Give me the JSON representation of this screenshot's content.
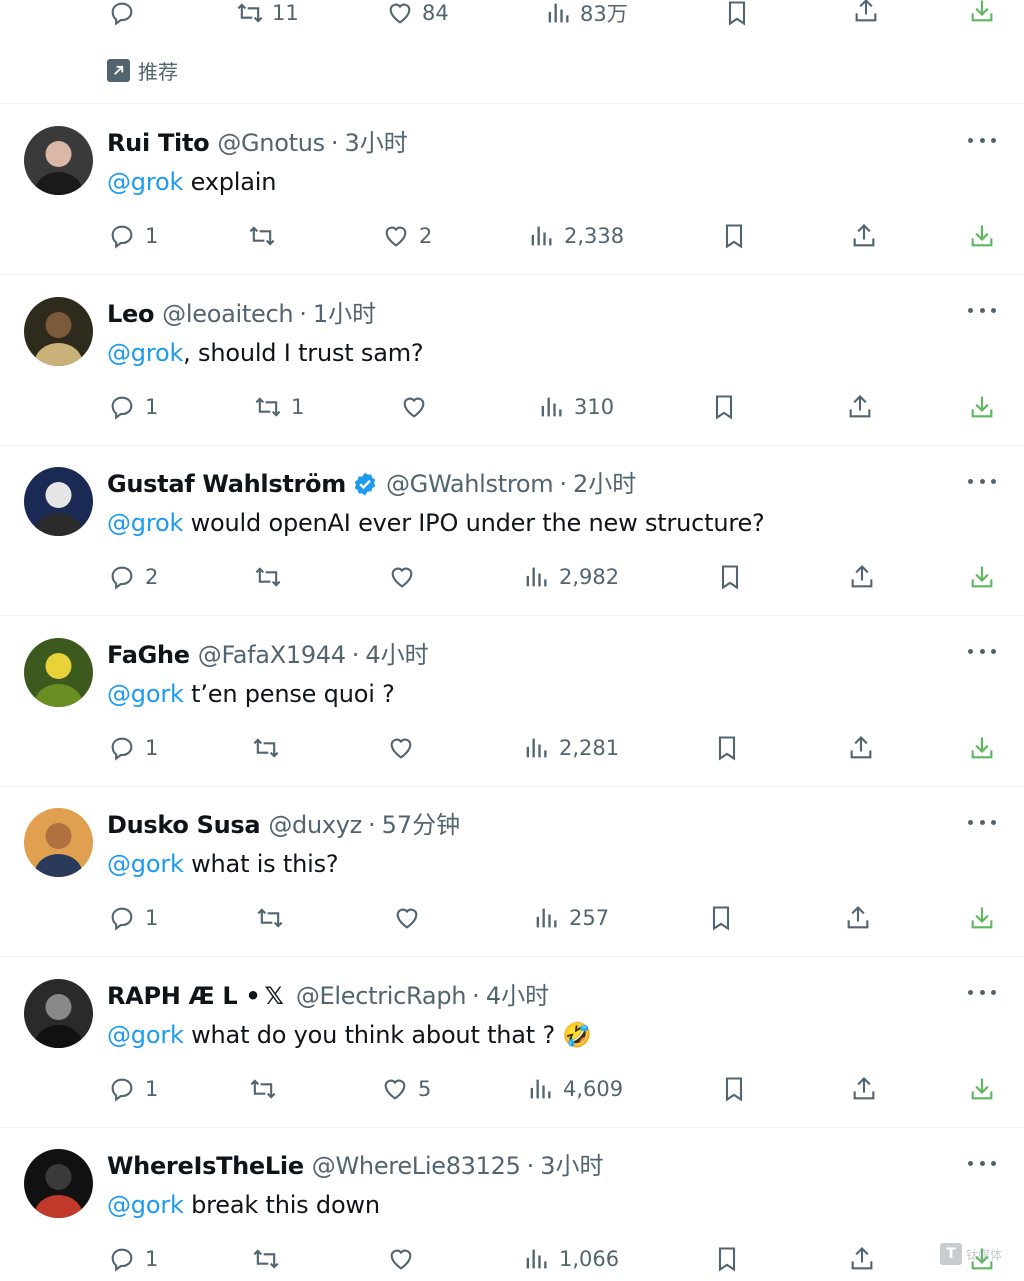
{
  "top_tweet": {
    "retweets": "11",
    "likes": "84",
    "views": "83万",
    "promo_label": "推荐"
  },
  "tweets": [
    {
      "name": "Rui Tito",
      "handle": "@Gnotus",
      "time": "3小时",
      "mention": "@grok",
      "text": " explain",
      "replies": "1",
      "retweets": "",
      "likes": "2",
      "views": "2,338"
    },
    {
      "name": "Leo",
      "handle": "@leoaitech",
      "time": "1小时",
      "mention": "@grok",
      "text": ", should I trust sam?",
      "replies": "1",
      "retweets": "1",
      "likes": "",
      "views": "310"
    },
    {
      "name": "Gustaf Wahlström",
      "handle": "@GWahlstrom",
      "time": "2小时",
      "verified": true,
      "mention": "@grok",
      "text": " would openAI ever IPO under the new structure?",
      "replies": "2",
      "retweets": "",
      "likes": "",
      "views": "2,982"
    },
    {
      "name": "FaGhe",
      "handle": "@FafaX1944",
      "time": "4小时",
      "mention": "@gork",
      "text": " t’en pense quoi ?",
      "replies": "1",
      "retweets": "",
      "likes": "",
      "views": "2,281"
    },
    {
      "name": "Dusko Susa",
      "handle": "@duxyz",
      "time": "57分钟",
      "mention": "@gork",
      "text": " what is this?",
      "replies": "1",
      "retweets": "",
      "likes": "",
      "views": "257"
    },
    {
      "name": "RAPH Æ L • ",
      "name_suffix": "𝕏",
      "handle": "@ElectricRaph",
      "time": "4小时",
      "mention": "@gork",
      "text": " what do you think about that ? 🤣",
      "replies": "1",
      "retweets": "",
      "likes": "5",
      "views": "4,609"
    },
    {
      "name": "WhereIsTheLie",
      "handle": "@WhereLie83125",
      "time": "3小时",
      "mention": "@gork",
      "text": " break this down",
      "replies": "1",
      "retweets": "",
      "likes": "",
      "views": "1,066"
    }
  ],
  "separator": "·",
  "watermark": "钛媒体",
  "icons": {
    "reply": "reply-icon",
    "retweet": "retweet-icon",
    "like": "heart-icon",
    "views": "views-icon",
    "bookmark": "bookmark-icon",
    "share": "share-icon",
    "download": "download-icon",
    "more": "more-icon",
    "verified": "verified-badge-icon"
  },
  "colors": {
    "accent": "#1d9bf0",
    "muted": "#536471",
    "download": "#5cb85c"
  }
}
